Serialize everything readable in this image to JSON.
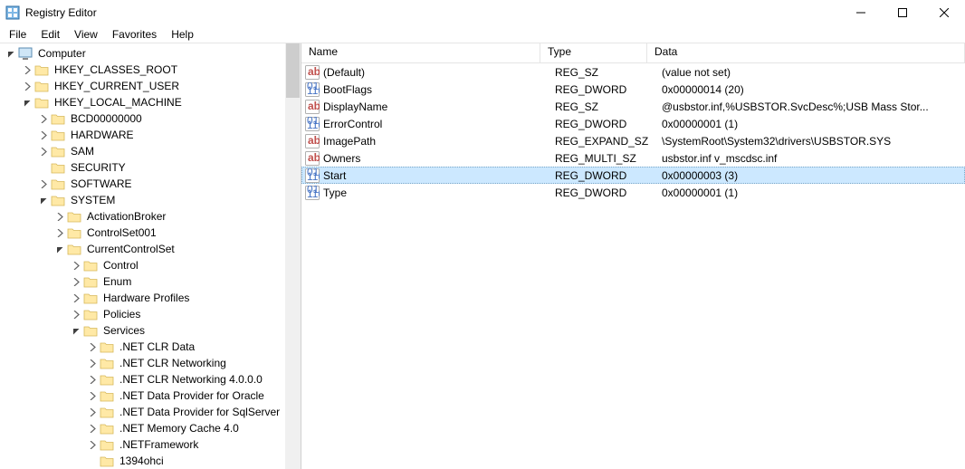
{
  "app": {
    "title": "Registry Editor"
  },
  "menu": {
    "file": "File",
    "edit": "Edit",
    "view": "View",
    "favorites": "Favorites",
    "help": "Help"
  },
  "tree": [
    {
      "indent": 0,
      "expander": "down",
      "icon": "pc",
      "label": "Computer"
    },
    {
      "indent": 1,
      "expander": "right",
      "icon": "folder",
      "label": "HKEY_CLASSES_ROOT"
    },
    {
      "indent": 1,
      "expander": "right",
      "icon": "folder",
      "label": "HKEY_CURRENT_USER"
    },
    {
      "indent": 1,
      "expander": "down",
      "icon": "folder",
      "label": "HKEY_LOCAL_MACHINE"
    },
    {
      "indent": 2,
      "expander": "right",
      "icon": "folder",
      "label": "BCD00000000"
    },
    {
      "indent": 2,
      "expander": "right",
      "icon": "folder",
      "label": "HARDWARE"
    },
    {
      "indent": 2,
      "expander": "right",
      "icon": "folder",
      "label": "SAM"
    },
    {
      "indent": 2,
      "expander": "none",
      "icon": "folder",
      "label": "SECURITY"
    },
    {
      "indent": 2,
      "expander": "right",
      "icon": "folder",
      "label": "SOFTWARE"
    },
    {
      "indent": 2,
      "expander": "down",
      "icon": "folder",
      "label": "SYSTEM"
    },
    {
      "indent": 3,
      "expander": "right",
      "icon": "folder",
      "label": "ActivationBroker"
    },
    {
      "indent": 3,
      "expander": "right",
      "icon": "folder",
      "label": "ControlSet001"
    },
    {
      "indent": 3,
      "expander": "down",
      "icon": "folder",
      "label": "CurrentControlSet"
    },
    {
      "indent": 4,
      "expander": "right",
      "icon": "folder",
      "label": "Control"
    },
    {
      "indent": 4,
      "expander": "right",
      "icon": "folder",
      "label": "Enum"
    },
    {
      "indent": 4,
      "expander": "right",
      "icon": "folder",
      "label": "Hardware Profiles"
    },
    {
      "indent": 4,
      "expander": "right",
      "icon": "folder",
      "label": "Policies"
    },
    {
      "indent": 4,
      "expander": "down",
      "icon": "folder",
      "label": "Services"
    },
    {
      "indent": 5,
      "expander": "right",
      "icon": "folder",
      "label": ".NET CLR Data"
    },
    {
      "indent": 5,
      "expander": "right",
      "icon": "folder",
      "label": ".NET CLR Networking"
    },
    {
      "indent": 5,
      "expander": "right",
      "icon": "folder",
      "label": ".NET CLR Networking 4.0.0.0"
    },
    {
      "indent": 5,
      "expander": "right",
      "icon": "folder",
      "label": ".NET Data Provider for Oracle"
    },
    {
      "indent": 5,
      "expander": "right",
      "icon": "folder",
      "label": ".NET Data Provider for SqlServer"
    },
    {
      "indent": 5,
      "expander": "right",
      "icon": "folder",
      "label": ".NET Memory Cache 4.0"
    },
    {
      "indent": 5,
      "expander": "right",
      "icon": "folder",
      "label": ".NETFramework"
    },
    {
      "indent": 5,
      "expander": "none",
      "icon": "folder",
      "label": "1394ohci"
    }
  ],
  "columns": {
    "name": "Name",
    "type": "Type",
    "data": "Data"
  },
  "values": [
    {
      "icon": "sz",
      "name": "(Default)",
      "type": "REG_SZ",
      "data": "(value not set)",
      "selected": false
    },
    {
      "icon": "bin",
      "name": "BootFlags",
      "type": "REG_DWORD",
      "data": "0x00000014 (20)",
      "selected": false
    },
    {
      "icon": "sz",
      "name": "DisplayName",
      "type": "REG_SZ",
      "data": "@usbstor.inf,%USBSTOR.SvcDesc%;USB Mass Stor...",
      "selected": false
    },
    {
      "icon": "bin",
      "name": "ErrorControl",
      "type": "REG_DWORD",
      "data": "0x00000001 (1)",
      "selected": false
    },
    {
      "icon": "sz",
      "name": "ImagePath",
      "type": "REG_EXPAND_SZ",
      "data": "\\SystemRoot\\System32\\drivers\\USBSTOR.SYS",
      "selected": false
    },
    {
      "icon": "sz",
      "name": "Owners",
      "type": "REG_MULTI_SZ",
      "data": "usbstor.inf v_mscdsc.inf",
      "selected": false
    },
    {
      "icon": "bin",
      "name": "Start",
      "type": "REG_DWORD",
      "data": "0x00000003 (3)",
      "selected": true
    },
    {
      "icon": "bin",
      "name": "Type",
      "type": "REG_DWORD",
      "data": "0x00000001 (1)",
      "selected": false
    }
  ]
}
